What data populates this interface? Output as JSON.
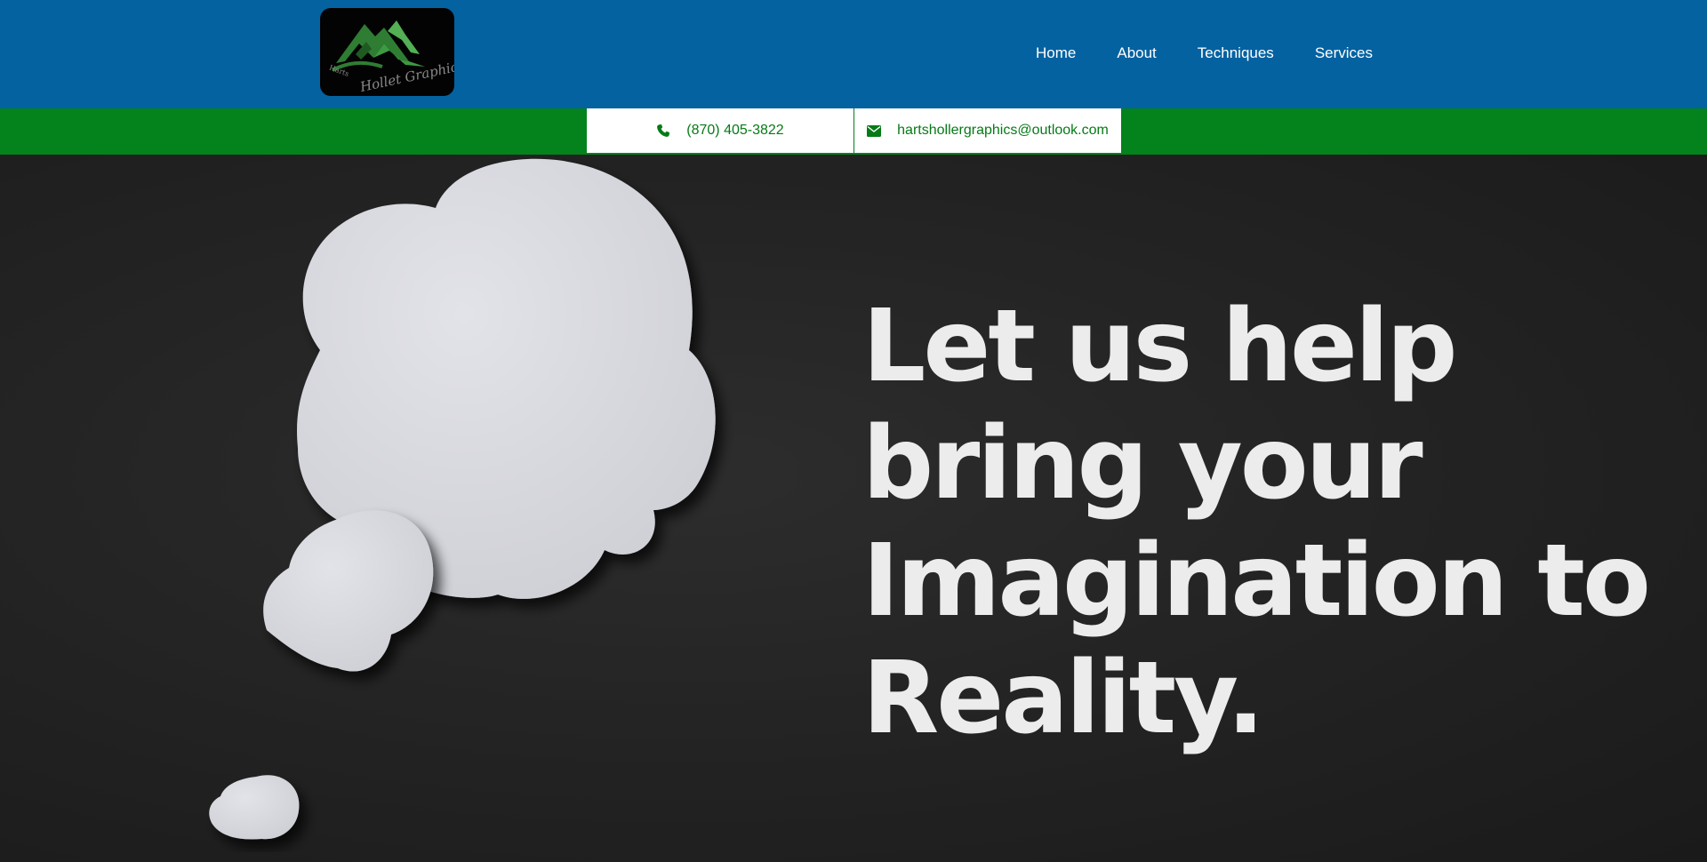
{
  "brand": {
    "logo_text": "Harts Holler Graphics",
    "colors": {
      "header_blue": "#0462a1",
      "contact_green": "#04821c",
      "headline_text": "#ececec"
    }
  },
  "nav": {
    "items": [
      {
        "label": "Home"
      },
      {
        "label": "About"
      },
      {
        "label": "Techniques"
      },
      {
        "label": "Services"
      }
    ]
  },
  "contact": {
    "phone": "(870) 405-3822",
    "phone_icon": "phone-icon",
    "email": "hartshollergraphics@outlook.com",
    "email_icon": "envelope-icon"
  },
  "hero": {
    "headline": "Let us help bring your Imagination to Reality.",
    "image": "paper-thought-bubbles"
  }
}
